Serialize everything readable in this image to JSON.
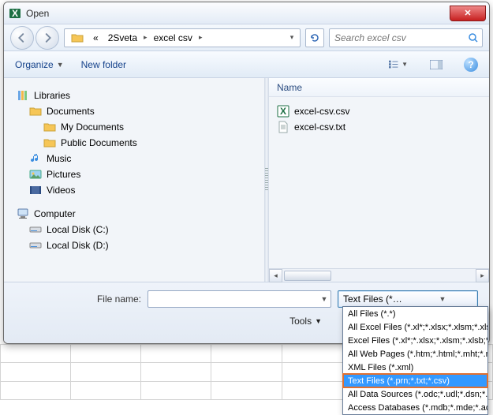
{
  "title": "Open",
  "nav": {
    "folder_icon": "folder-icon",
    "chevrons": "«",
    "crumb1": "2Sveta",
    "crumb2": "excel csv",
    "search_placeholder": "Search excel csv"
  },
  "toolbar": {
    "organize": "Organize",
    "newfolder": "New folder"
  },
  "tree": {
    "libraries": "Libraries",
    "documents": "Documents",
    "mydocs": "My Documents",
    "publicdocs": "Public Documents",
    "music": "Music",
    "pictures": "Pictures",
    "videos": "Videos",
    "computer": "Computer",
    "diskC": "Local Disk (C:)",
    "diskD": "Local Disk (D:)"
  },
  "list": {
    "col_name": "Name",
    "files": [
      {
        "name": "excel-csv.csv",
        "icon": "excel"
      },
      {
        "name": "excel-csv.txt",
        "icon": "txt"
      }
    ]
  },
  "bottom": {
    "filename_label": "File name:",
    "filename_value": "",
    "filetype_selected": "Text Files (*.prn;*.txt;*.csv)",
    "tools": "Tools"
  },
  "filetype_options": [
    "All Files (*.*)",
    "All Excel Files (*.xl*;*.xlsx;*.xlsm;*.xlsb;*.xls",
    "Excel Files (*.xl*;*.xlsx;*.xlsm;*.xlsb;*.xlam",
    "All Web Pages (*.htm;*.html;*.mht;*.mh",
    "XML Files (*.xml)",
    "Text Files (*.prn;*.txt;*.csv)",
    "All Data Sources (*.odc;*.udl;*.dsn;*.mdb",
    "Access Databases (*.mdb;*.mde;*.accdb"
  ],
  "filetype_selected_index": 5
}
